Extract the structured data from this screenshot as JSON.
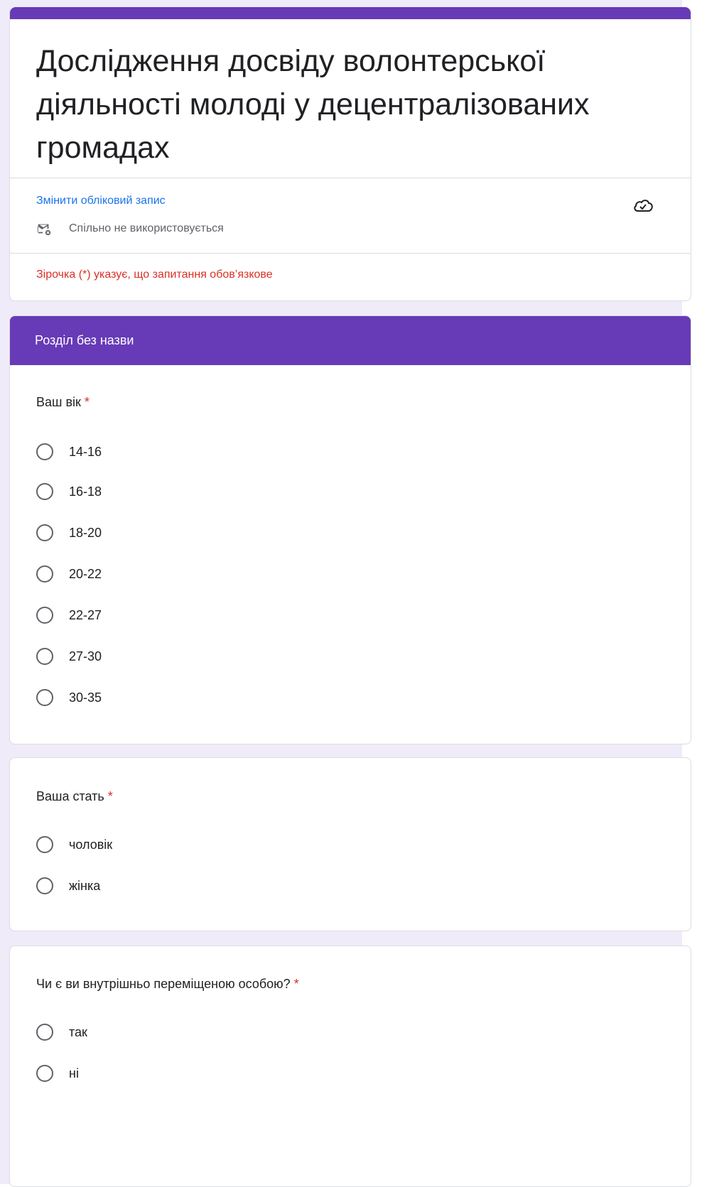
{
  "form": {
    "title": "Дослідження досвіду волонтерської діяльності молоді у децентралізованих громадах",
    "switch_account": "Змінити обліковий запис",
    "not_shared": "Спільно не використовується",
    "required_note": "Зірочка (*) указує, що запитання обов’язкове",
    "accent_color": "#673ab7"
  },
  "section": {
    "title": "Розділ без назви"
  },
  "questions": [
    {
      "title": "Ваш вік",
      "required_mark": "*",
      "options": [
        "14-16",
        "16-18",
        "18-20",
        "20-22",
        "22-27",
        "27-30",
        "30-35"
      ]
    },
    {
      "title": "Ваша стать",
      "required_mark": "*",
      "options": [
        "чоловік",
        "жінка"
      ]
    },
    {
      "title": "Чи є ви внутрішньо переміщеною особою?",
      "required_mark": "*",
      "options": [
        "так",
        "ні"
      ]
    }
  ],
  "icons": {
    "mail": "mail-not-shared-icon",
    "cloud": "cloud-saved-icon"
  }
}
